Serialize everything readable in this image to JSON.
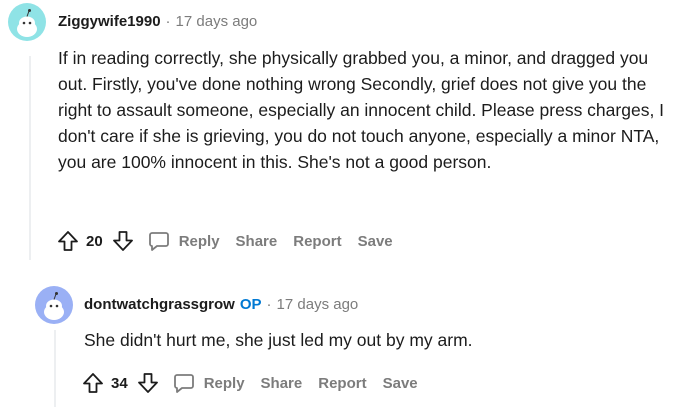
{
  "colors": {
    "text": "#1c1c1c",
    "meta": "#7c7c7c",
    "op_badge": "#0079d3",
    "avatar1_bg": "#8fe3e6",
    "avatar2_bg": "#9ab0f5",
    "thread_line": "#edeff1"
  },
  "comments": [
    {
      "username": "Ziggywife1990",
      "separator": "·",
      "time": "17 days ago",
      "avatar_icon": "snoo-avatar-icon",
      "body": "If in reading correctly, she physically grabbed you, a minor, and dragged you out. Firstly, you've done nothing wrong Secondly, grief does not give you the right to assault someone, especially an innocent child. Please press charges, I don't care if she is grieving, you do not touch anyone, especially a minor NTA, you are 100% innocent in this. She's not a good person.",
      "votes": "20",
      "actions": {
        "reply": "Reply",
        "share": "Share",
        "report": "Report",
        "save": "Save"
      }
    },
    {
      "username": "dontwatchgrassgrow",
      "op_badge": "OP",
      "separator": "·",
      "time": "17 days ago",
      "avatar_icon": "snoo-avatar-icon",
      "body": "She didn't hurt me, she just led my out by my arm.",
      "votes": "34",
      "actions": {
        "reply": "Reply",
        "share": "Share",
        "report": "Report",
        "save": "Save"
      }
    }
  ]
}
